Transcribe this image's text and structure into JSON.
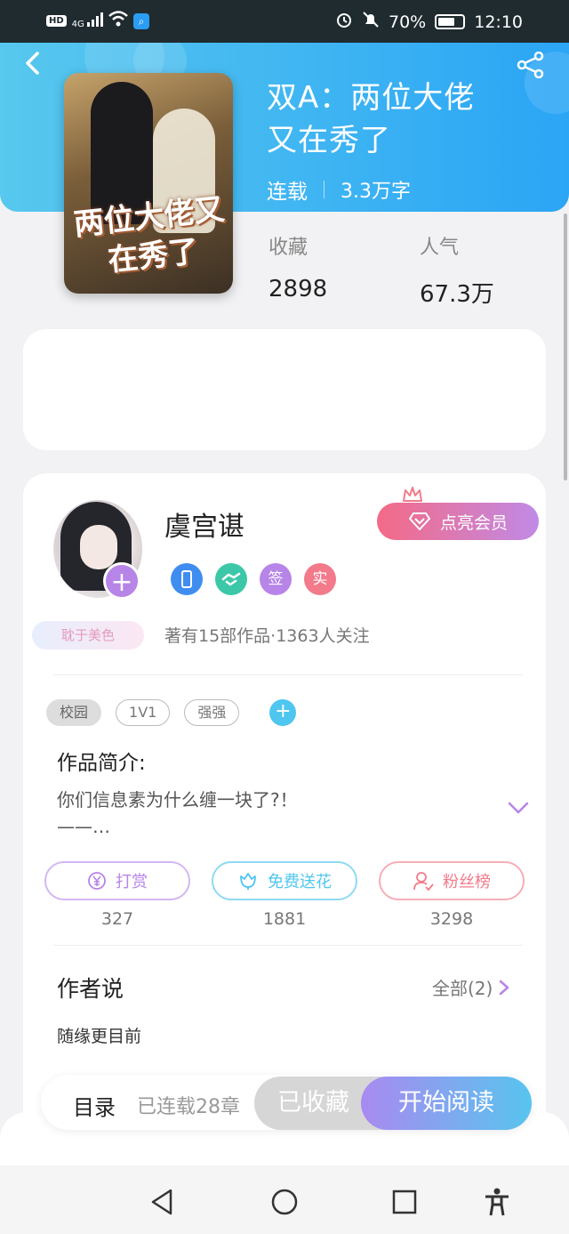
{
  "status_bar": {
    "network_type": "HD",
    "signal_label": "4G",
    "battery": "70%",
    "time": "12:10",
    "icons": [
      "hd-icon",
      "signal-icon",
      "wifi-icon",
      "app-search-icon",
      "alarm-icon",
      "mute-icon",
      "battery-icon"
    ]
  },
  "header": {
    "back_icon": "chevron-left-icon",
    "share_icon": "share-icon",
    "gradient_start": "#57c8ee",
    "gradient_end": "#2ba5f5"
  },
  "book": {
    "cover_text": "两位大佬又在秀了",
    "title_line1": "双A：两位大佬",
    "title_line2": "又在秀了",
    "status": "连载",
    "word_count": "3.3万字",
    "favorites_label": "收藏",
    "favorites_value": "2898",
    "popularity_label": "人气",
    "popularity_value": "67.3万"
  },
  "author": {
    "name": "虞宫谌",
    "follow_icon": "plus-icon",
    "vip_button": "点亮会员",
    "badges": [
      {
        "icon": "phone-icon",
        "text": "",
        "color": "#3f8df0"
      },
      {
        "icon": "handshake-icon",
        "text": "",
        "color": "#3cc8a8"
      },
      {
        "icon": "sign-icon",
        "text": "签",
        "color": "#b784e8"
      },
      {
        "icon": "verified-icon",
        "text": "实",
        "color": "#f27a8a"
      }
    ],
    "title_tag": "耽于美色",
    "works_summary": "著有15部作品·1363人关注"
  },
  "tags": {
    "items": [
      "校园",
      "1V1",
      "强强"
    ],
    "add_icon": "plus-icon"
  },
  "intro": {
    "label": "作品简介:",
    "line1": "你们信息素为什么缠一块了?！",
    "line2": "——…",
    "expand_icon": "chevron-down-icon"
  },
  "actions": [
    {
      "label": "打赏",
      "icon": "yen-icon",
      "count": "327",
      "color": "#b784e8"
    },
    {
      "label": "免费送花",
      "icon": "flower-icon",
      "count": "1881",
      "color": "#4fc6ef"
    },
    {
      "label": "粉丝榜",
      "icon": "user-rank-icon",
      "count": "3298",
      "color": "#f27a8a"
    }
  ],
  "author_say": {
    "title": "作者说",
    "all_label": "全部(2)",
    "text": "随缘更目前"
  },
  "bottom_bar": {
    "toc": "目录",
    "chapters": "已连载28章",
    "collected": "已收藏",
    "read": "开始阅读"
  },
  "navbar": {
    "icons": [
      "back-triangle-icon",
      "home-circle-icon",
      "recents-square-icon",
      "accessibility-icon"
    ]
  }
}
